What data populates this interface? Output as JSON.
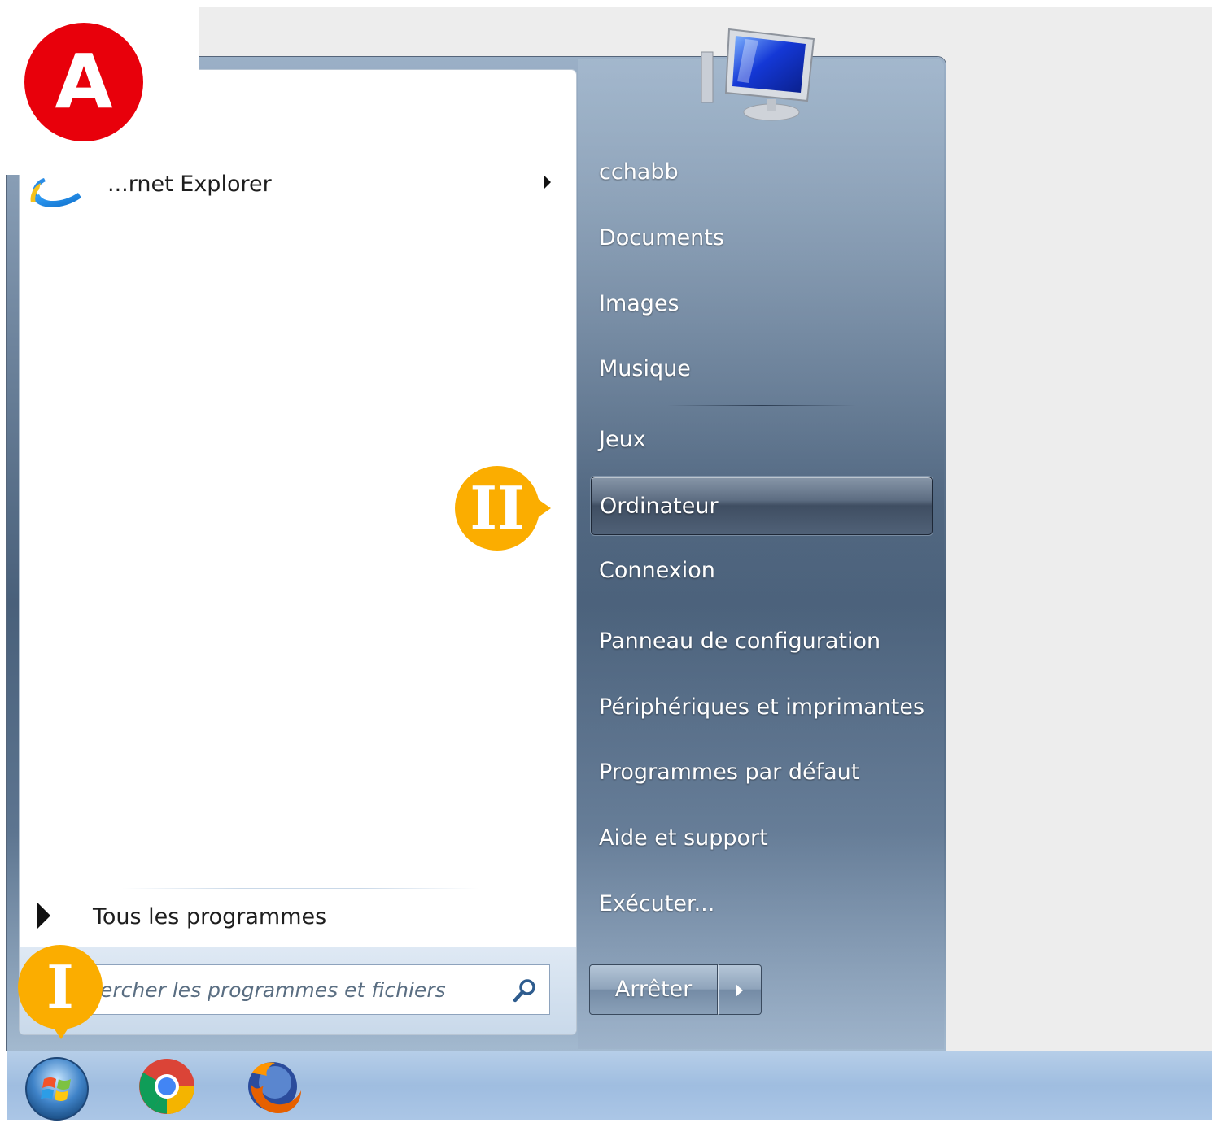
{
  "start_menu": {
    "pinned_programs": [
      {
        "label": "...rnet Explorer",
        "icon": "internet-explorer-icon",
        "has_submenu": true
      }
    ],
    "all_programs_label": "Tous les programmes",
    "search": {
      "placeholder": "ercher les programmes et fichiers",
      "icon": "search-icon"
    },
    "user_picture_icon": "computer-monitor-icon",
    "right_items": [
      {
        "label": "cchabb",
        "name": "user-folder"
      },
      {
        "label": "Documents",
        "name": "documents"
      },
      {
        "label": "Images",
        "name": "images"
      },
      {
        "label": "Musique",
        "name": "musique"
      },
      {
        "label": "Jeux",
        "name": "jeux"
      },
      {
        "label": "Ordinateur",
        "name": "ordinateur",
        "highlighted": true
      },
      {
        "label": "Connexion",
        "name": "connexion"
      },
      {
        "label": "Panneau de configuration",
        "name": "panneau-de-configuration"
      },
      {
        "label": "Périphériques et imprimantes",
        "name": "peripheriques-et-imprimantes"
      },
      {
        "label": "Programmes par défaut",
        "name": "programmes-par-defaut"
      },
      {
        "label": "Aide et support",
        "name": "aide-et-support"
      },
      {
        "label": "Exécuter...",
        "name": "executer"
      }
    ],
    "shutdown": {
      "label": "Arrêter",
      "arrow_icon": "triangle-right-icon"
    }
  },
  "taskbar": {
    "apps": [
      {
        "name": "start-orb",
        "icon": "windows-logo-icon"
      },
      {
        "name": "chrome",
        "icon": "chrome-icon"
      },
      {
        "name": "firefox",
        "icon": "firefox-icon"
      }
    ]
  },
  "annotations": {
    "badge": "A",
    "step_1": "I",
    "step_2": "II"
  },
  "colors": {
    "badge_red": "#e8000b",
    "marker_orange": "#fbad00",
    "taskbar_blue": "#a9c4e4",
    "highlight": "#506177"
  }
}
